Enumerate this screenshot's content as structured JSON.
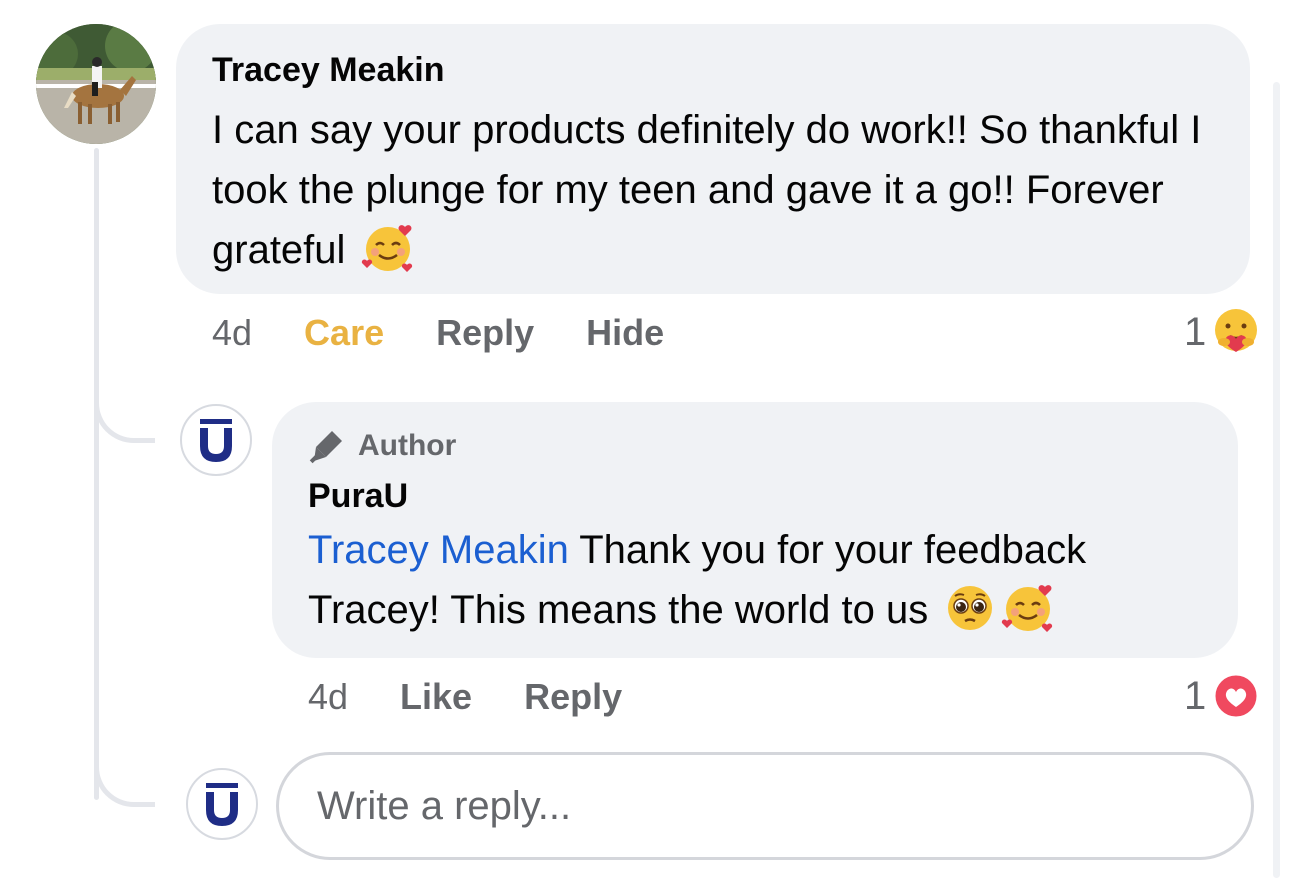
{
  "comment": {
    "author": "Tracey Meakin",
    "text": "I can say your products definitely do work!! So thankful I took the plunge for my teen and gave it a go!! Forever grateful",
    "emoji": "smiling-face-with-hearts",
    "time": "4d",
    "reaction_label": "Care",
    "reply_label": "Reply",
    "hide_label": "Hide",
    "reaction_count": "1",
    "reaction_icon": "care-reaction"
  },
  "reply": {
    "badge": "Author",
    "author": "PuraU",
    "mention": "Tracey Meakin",
    "text": " Thank you for your feedback Tracey! This means the world to us",
    "emojis": [
      "pleading-face",
      "smiling-face-with-hearts"
    ],
    "time": "4d",
    "like_label": "Like",
    "reply_label": "Reply",
    "reaction_count": "1",
    "reaction_icon": "love-reaction"
  },
  "reply_box": {
    "placeholder": "Write a reply..."
  },
  "colors": {
    "bubble": "#f0f2f5",
    "care": "#e9b242",
    "mention": "#1b5fd1",
    "muted": "#65676b",
    "brand_navy": "#1f2d86",
    "love": "#f0495f"
  }
}
